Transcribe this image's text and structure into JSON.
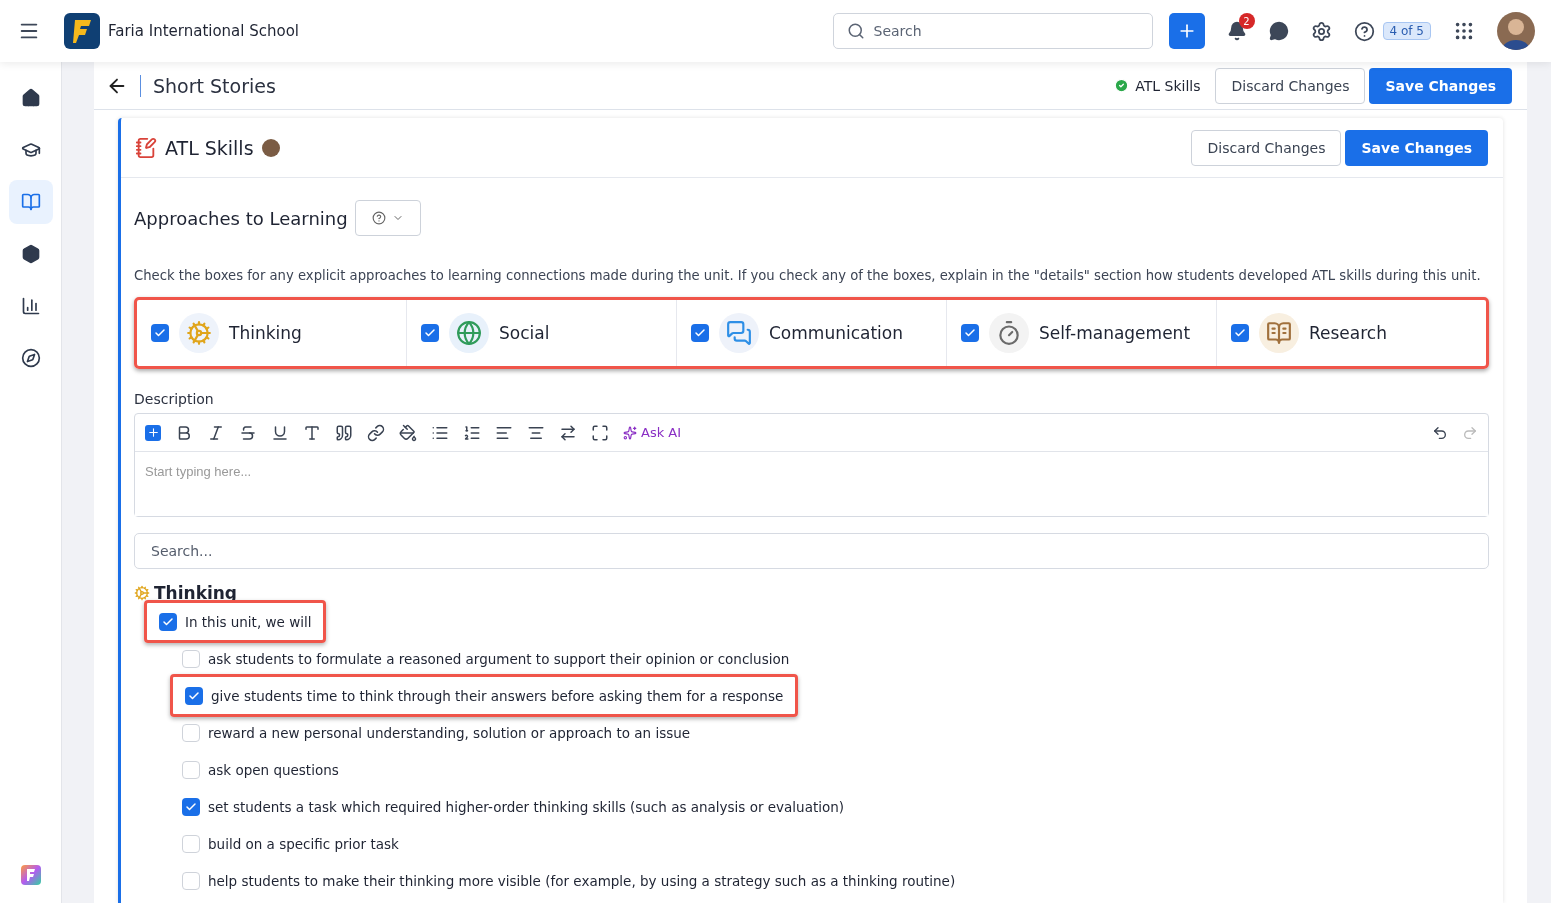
{
  "topbar": {
    "school": "Faria International School",
    "search_placeholder": "Search",
    "notifications": "2",
    "help_badge": "4 of 5"
  },
  "sidebar": {
    "items": [
      {
        "kind": "home",
        "selected": false
      },
      {
        "kind": "school",
        "selected": false
      },
      {
        "kind": "book",
        "selected": true
      },
      {
        "kind": "box",
        "selected": false
      },
      {
        "kind": "chart",
        "selected": false
      },
      {
        "kind": "compass",
        "selected": false
      }
    ]
  },
  "page_header": {
    "title": "Short Stories",
    "status": "ATL Skills",
    "discard": "Discard Changes",
    "save": "Save Changes"
  },
  "card": {
    "title": "ATL Skills",
    "discard": "Discard Changes",
    "save": "Save Changes",
    "section_title": "Approaches to Learning",
    "instructions": "Check the boxes for any explicit approaches to learning connections made during the unit. If you check any of the boxes, explain in the \"details\" section how students developed ATL skills during this unit.",
    "skills_highlighted": true,
    "skills": [
      {
        "kind": "thinking",
        "label": "Thinking",
        "checked": true
      },
      {
        "kind": "social",
        "label": "Social",
        "checked": true
      },
      {
        "kind": "communication",
        "label": "Communication",
        "checked": true
      },
      {
        "kind": "self-management",
        "label": "Self-management",
        "checked": true
      },
      {
        "kind": "research",
        "label": "Research",
        "checked": true
      }
    ],
    "description": {
      "label": "Description",
      "ask_ai": "Ask AI",
      "placeholder": "Start typing here..."
    },
    "search_placeholder": "Search...",
    "group": {
      "title": "Thinking",
      "intro": {
        "label": "In this unit, we will",
        "checked": true,
        "highlighted": true
      },
      "items": [
        {
          "label": "ask students to formulate a reasoned argument to support their opinion or conclusion",
          "checked": false,
          "highlighted": false
        },
        {
          "label": "give students time to think through their answers before asking them for a response",
          "checked": true,
          "highlighted": true
        },
        {
          "label": "reward a new personal understanding, solution or approach to an issue",
          "checked": false,
          "highlighted": false
        },
        {
          "label": "ask open questions",
          "checked": false,
          "highlighted": false
        },
        {
          "label": "set students a task which required higher-order thinking skills (such as analysis or evaluation)",
          "checked": true,
          "highlighted": false
        },
        {
          "label": "build on a specific prior task",
          "checked": false,
          "highlighted": false
        },
        {
          "label": "help students to make their thinking more visible (for example, by using a strategy such as a thinking routine)",
          "checked": false,
          "highlighted": false
        }
      ]
    }
  }
}
